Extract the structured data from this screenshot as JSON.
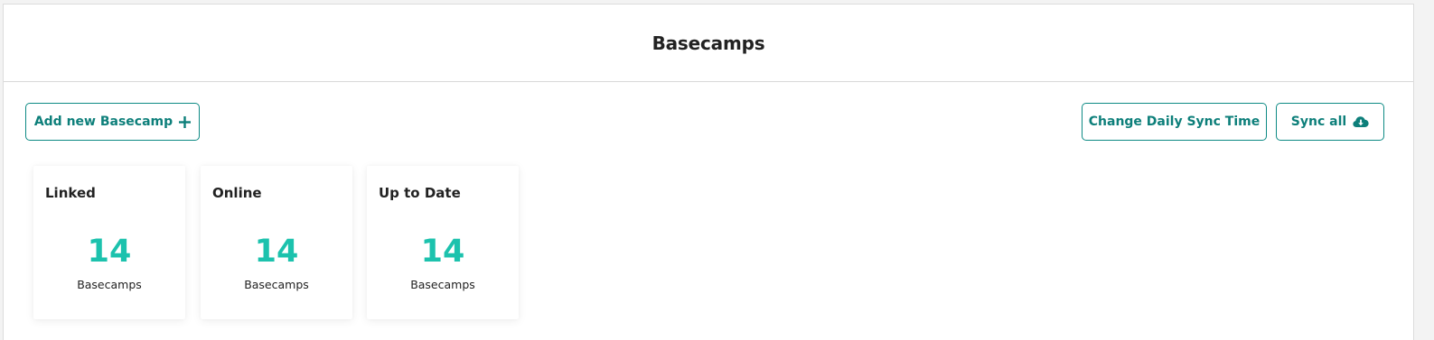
{
  "header": {
    "title": "Basecamps"
  },
  "toolbar": {
    "add_label": "Add new Basecamp",
    "sync_time_label": "Change Daily Sync Time",
    "sync_all_label": "Sync all"
  },
  "icons": {
    "add": "plus-icon",
    "sync": "cloud-download-icon"
  },
  "colors": {
    "accent": "#0d7f7a",
    "value": "#1cc2ad",
    "text": "#222222"
  },
  "stats": [
    {
      "title": "Linked",
      "value": "14",
      "unit": "Basecamps"
    },
    {
      "title": "Online",
      "value": "14",
      "unit": "Basecamps"
    },
    {
      "title": "Up to Date",
      "value": "14",
      "unit": "Basecamps"
    }
  ]
}
